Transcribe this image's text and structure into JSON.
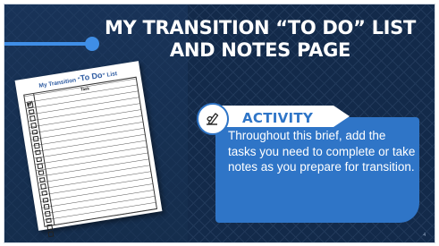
{
  "slide": {
    "title_line1": "MY TRANSITION “TO DO” LIST",
    "title_line2": "AND NOTES PAGE",
    "page_number": "4",
    "colors": {
      "background": "#132a4a",
      "accent": "#3f8ee6",
      "panel": "#2f75c7"
    }
  },
  "worksheet": {
    "title_prefix": "My Transition “",
    "title_emphasis": "To Do",
    "title_suffix": "” List",
    "column_header": "Task"
  },
  "activity": {
    "label": "ACTIVITY",
    "icon": "writing-hand-icon",
    "text": "Throughout this brief, add the tasks you need to complete or take notes as you prepare for transition."
  }
}
